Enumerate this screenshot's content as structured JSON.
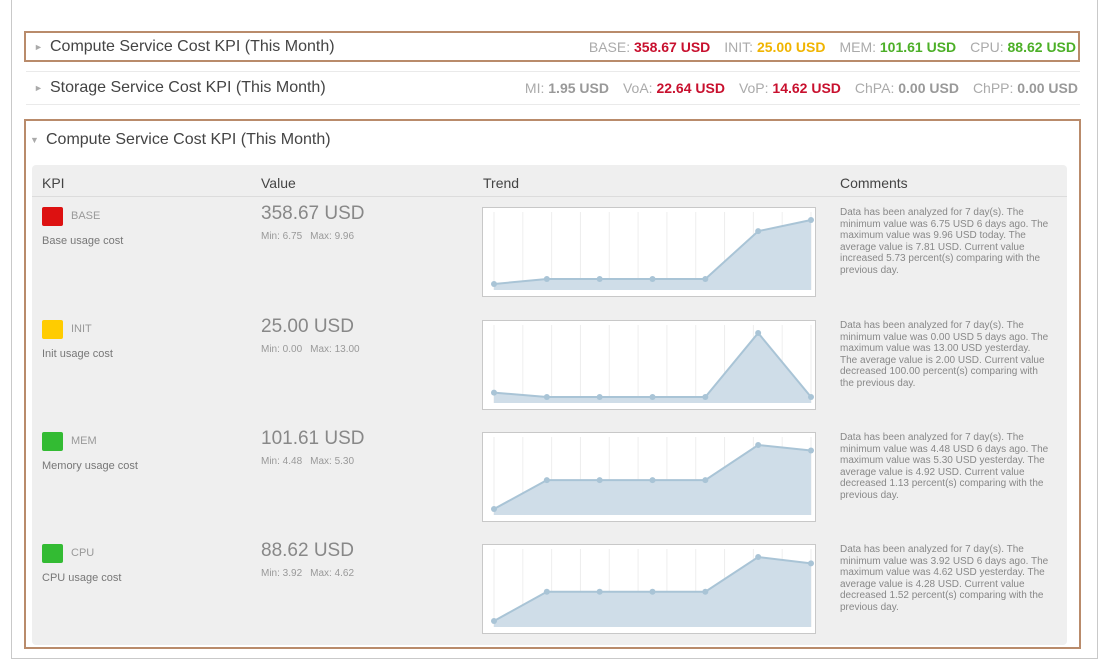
{
  "summary_bars": [
    {
      "title": "Compute Service Cost KPI (This Month)",
      "metrics": [
        {
          "label": "BASE:",
          "value": "358.67 USD",
          "color": "red"
        },
        {
          "label": "INIT:",
          "value": "25.00 USD",
          "color": "yellow"
        },
        {
          "label": "MEM:",
          "value": "101.61 USD",
          "color": "green"
        },
        {
          "label": "CPU:",
          "value": "88.62 USD",
          "color": "green"
        }
      ]
    },
    {
      "title": "Storage Service Cost KPI (This Month)",
      "metrics": [
        {
          "label": "MI:",
          "value": "1.95 USD",
          "color": "grey"
        },
        {
          "label": "VoA:",
          "value": "22.64 USD",
          "color": "red"
        },
        {
          "label": "VoP:",
          "value": "14.62 USD",
          "color": "red"
        },
        {
          "label": "ChPA:",
          "value": "0.00 USD",
          "color": "grey"
        },
        {
          "label": "ChPP:",
          "value": "0.00 USD",
          "color": "grey"
        }
      ]
    }
  ],
  "panel": {
    "title": "Compute Service Cost KPI (This Month)",
    "headers": {
      "kpi": "KPI",
      "value": "Value",
      "trend": "Trend",
      "comments": "Comments"
    },
    "rows": [
      {
        "name": "BASE",
        "description": "Base usage cost",
        "status_color": "#dd1111",
        "value": "358.67 USD",
        "min": "Min: 6.75",
        "max": "Max: 9.96",
        "trend": [
          6.75,
          7.0,
          7.0,
          7.0,
          7.0,
          9.4,
          9.96
        ],
        "comment": "Data has been analyzed for 7 day(s). The minimum value was 6.75 USD 6 days ago. The maximum value was 9.96 USD today. The average value is 7.81 USD. Current value increased 5.73 percent(s) comparing with the previous day."
      },
      {
        "name": "INIT",
        "description": "Init usage cost",
        "status_color": "#ffcc00",
        "value": "25.00 USD",
        "min": "Min: 0.00",
        "max": "Max: 13.00",
        "trend": [
          0.9,
          0.0,
          0.0,
          0.0,
          0.0,
          13.0,
          0.0
        ],
        "comment": "Data has been analyzed for 7 day(s). The minimum value was 0.00 USD 5 days ago. The maximum value was 13.00 USD yesterday. The average value is 2.00 USD. Current value decreased 100.00 percent(s) comparing with the previous day."
      },
      {
        "name": "MEM",
        "description": "Memory usage cost",
        "status_color": "#33bb33",
        "value": "101.61 USD",
        "min": "Min: 4.48",
        "max": "Max: 5.30",
        "trend": [
          4.48,
          4.85,
          4.85,
          4.85,
          4.85,
          5.3,
          5.23
        ],
        "comment": "Data has been analyzed for 7 day(s). The minimum value was 4.48 USD 6 days ago. The maximum value was 5.30 USD yesterday. The average value is 4.92 USD. Current value decreased 1.13 percent(s) comparing with the previous day."
      },
      {
        "name": "CPU",
        "description": "CPU usage cost",
        "status_color": "#33bb33",
        "value": "88.62 USD",
        "min": "Min: 3.92",
        "max": "Max: 4.62",
        "trend": [
          3.92,
          4.24,
          4.24,
          4.24,
          4.24,
          4.62,
          4.55
        ],
        "comment": "Data has been analyzed for 7 day(s). The minimum value was 3.92 USD 6 days ago. The maximum value was 4.62 USD yesterday. The average value is 4.28 USD. Current value decreased 1.52 percent(s) comparing with the previous day."
      }
    ]
  },
  "colors": {
    "accent_border": "#b98b6b",
    "trend_line": "#a9c4d6",
    "trend_fill": "#cfdde8"
  }
}
